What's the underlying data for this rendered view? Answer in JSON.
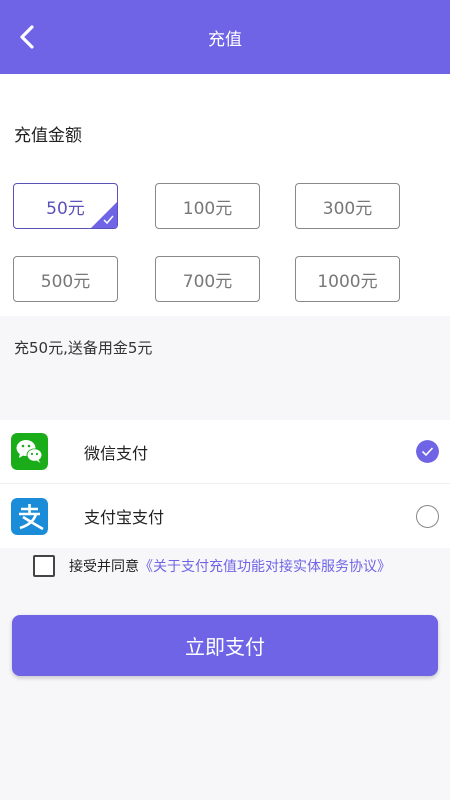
{
  "header": {
    "title": "充值",
    "back_icon": "chevron-left-icon"
  },
  "amount": {
    "label": "充值金额",
    "options": [
      {
        "label": "50元",
        "selected": true
      },
      {
        "label": "100元",
        "selected": false
      },
      {
        "label": "300元",
        "selected": false
      },
      {
        "label": "500元",
        "selected": false
      },
      {
        "label": "700元",
        "selected": false
      },
      {
        "label": "1000元",
        "selected": false
      }
    ],
    "bonus_text": "充50元,送备用金5元"
  },
  "payment": {
    "methods": [
      {
        "label": "微信支付",
        "icon": "wechat-pay-icon",
        "selected": true
      },
      {
        "label": "支付宝支付",
        "icon": "alipay-icon",
        "selected": false
      }
    ]
  },
  "agreement": {
    "prefix": "接受并同意",
    "link": "《关于支付充值功能对接实体服务协议》",
    "checked": false
  },
  "pay_button": {
    "label": "立即支付"
  },
  "colors": {
    "primary": "#6f64e6",
    "selected_border": "#5a52b8",
    "wechat": "#1aad19",
    "alipay": "#1a8cd8"
  }
}
